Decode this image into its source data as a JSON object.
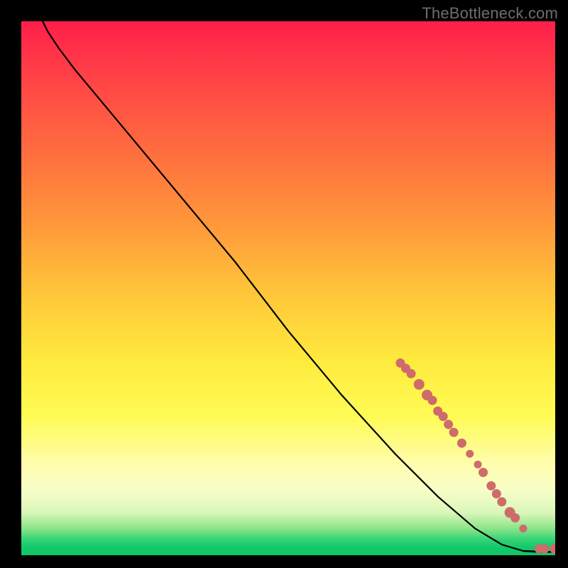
{
  "watermark": "TheBottleneck.com",
  "chart_data": {
    "type": "line",
    "title": "",
    "xlabel": "",
    "ylabel": "",
    "xlim": [
      0,
      100
    ],
    "ylim": [
      0,
      100
    ],
    "grid": false,
    "legend": false,
    "colors": {
      "curve": "#000000",
      "points": "#CE6B6B",
      "bg_top": "#FF1E4B",
      "bg_mid": "#FFEB3E",
      "bg_bottom": "#0EC768"
    },
    "curve_points": [
      {
        "x": 4,
        "y": 100
      },
      {
        "x": 5,
        "y": 98
      },
      {
        "x": 7,
        "y": 95
      },
      {
        "x": 10,
        "y": 91
      },
      {
        "x": 15,
        "y": 85
      },
      {
        "x": 20,
        "y": 79
      },
      {
        "x": 30,
        "y": 67
      },
      {
        "x": 40,
        "y": 55
      },
      {
        "x": 50,
        "y": 42
      },
      {
        "x": 60,
        "y": 30
      },
      {
        "x": 70,
        "y": 19
      },
      {
        "x": 78,
        "y": 11
      },
      {
        "x": 85,
        "y": 5
      },
      {
        "x": 90,
        "y": 2
      },
      {
        "x": 94,
        "y": 0.8
      },
      {
        "x": 97,
        "y": 0.6
      },
      {
        "x": 100,
        "y": 0.6
      }
    ],
    "data_points": [
      {
        "x": 71,
        "y": 36,
        "r": 6
      },
      {
        "x": 72,
        "y": 35,
        "r": 6
      },
      {
        "x": 73,
        "y": 34,
        "r": 6
      },
      {
        "x": 74.5,
        "y": 32,
        "r": 7
      },
      {
        "x": 76,
        "y": 30,
        "r": 7
      },
      {
        "x": 77,
        "y": 29,
        "r": 6
      },
      {
        "x": 78,
        "y": 27,
        "r": 6
      },
      {
        "x": 79,
        "y": 26,
        "r": 6
      },
      {
        "x": 80,
        "y": 24.5,
        "r": 6
      },
      {
        "x": 81,
        "y": 23,
        "r": 6
      },
      {
        "x": 82.5,
        "y": 21,
        "r": 6
      },
      {
        "x": 84,
        "y": 19,
        "r": 5
      },
      {
        "x": 85.5,
        "y": 17,
        "r": 5
      },
      {
        "x": 86.5,
        "y": 15.5,
        "r": 6
      },
      {
        "x": 88,
        "y": 13,
        "r": 6
      },
      {
        "x": 89,
        "y": 11.5,
        "r": 6
      },
      {
        "x": 90,
        "y": 10,
        "r": 6
      },
      {
        "x": 91.5,
        "y": 8,
        "r": 7
      },
      {
        "x": 92.5,
        "y": 7,
        "r": 6
      },
      {
        "x": 94,
        "y": 5,
        "r": 5
      },
      {
        "x": 97,
        "y": 1.2,
        "r": 6
      },
      {
        "x": 98,
        "y": 1.2,
        "r": 6
      },
      {
        "x": 100,
        "y": 1.2,
        "r": 7
      }
    ]
  }
}
